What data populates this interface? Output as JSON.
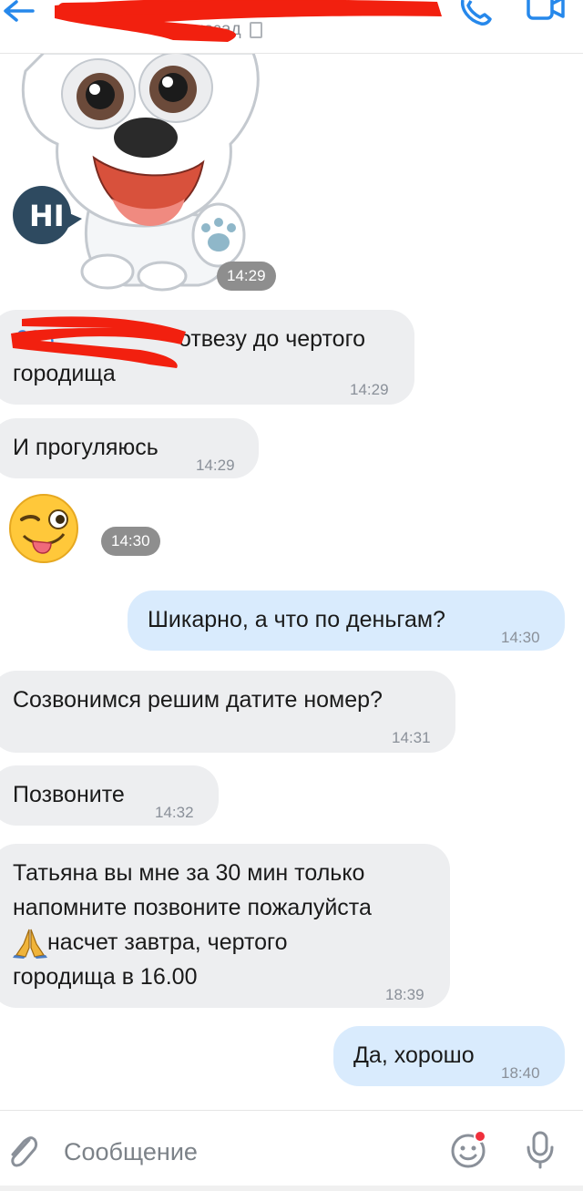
{
  "header": {
    "status_text": "назад",
    "icons": [
      "back-arrow-icon",
      "phone-icon",
      "video-call-icon"
    ]
  },
  "messages": [
    {
      "type": "sticker",
      "direction": "in",
      "sticker": "dog-hi-sticker",
      "badge_text": "HI",
      "time": "14:29"
    },
    {
      "type": "text",
      "direction": "in",
      "line1": "отвезу до чертого",
      "line2": "городища",
      "time": "14:29",
      "redacted_prefix": "905"
    },
    {
      "type": "text",
      "direction": "in",
      "text": "И прогуляюсь",
      "time": "14:29"
    },
    {
      "type": "emoji",
      "direction": "in",
      "emoji": "winking-tongue-emoji",
      "time": "14:30"
    },
    {
      "type": "text",
      "direction": "out",
      "text": "Шикарно, а что по деньгам?",
      "time": "14:30"
    },
    {
      "type": "text",
      "direction": "in",
      "text": "Созвонимся решим датите номер?",
      "time": "14:31"
    },
    {
      "type": "text",
      "direction": "in",
      "text": "Позвоните",
      "time": "14:32"
    },
    {
      "type": "text",
      "direction": "in",
      "line1": "Татьяна вы мне за 30 мин только",
      "line2": "напомните позвоните пожалуйста",
      "line3": "насчет завтра, чертого",
      "line4": "городища в 16.00",
      "time": "18:39"
    },
    {
      "type": "text",
      "direction": "out",
      "text": "Да, хорошо",
      "time": "18:40"
    }
  ],
  "input": {
    "placeholder": "Сообщение",
    "icons": [
      "attach-icon",
      "emoji-icon",
      "microphone-icon"
    ]
  },
  "colors": {
    "incoming_bubble": "#edeef0",
    "outgoing_bubble": "#d9ebfd",
    "accent": "#2688eb",
    "redaction": "#f2200f"
  }
}
